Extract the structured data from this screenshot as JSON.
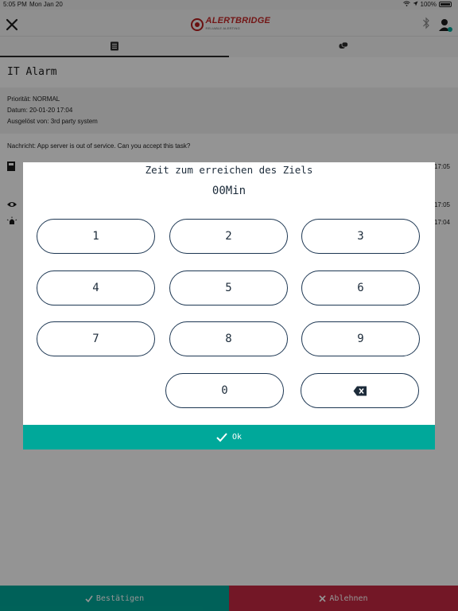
{
  "status_bar": {
    "time": "5:05 PM",
    "date": "Mon Jan 20",
    "battery": "100%"
  },
  "header": {
    "logo_text": "ALERTBRIDGE",
    "logo_subtext": "RELIABLE ALERTING"
  },
  "alarm": {
    "title": "IT Alarm",
    "priority": "Priorität: NORMAL",
    "date": "Datum: 20-01-20 17:04",
    "triggered_by": "Ausgelöst von: 3rd party system",
    "message": "Nachricht: App server is out of service. Can you accept this task?"
  },
  "history": [
    {
      "icon": "pager-icon",
      "time": "17:05"
    },
    {
      "icon": "eye-icon",
      "time": "17:05"
    },
    {
      "icon": "alarm-bell-icon",
      "time": "17:04"
    }
  ],
  "dialog": {
    "title": "Zeit zum erreichen des Ziels",
    "value": "00Min",
    "keys": [
      "1",
      "2",
      "3",
      "4",
      "5",
      "6",
      "7",
      "8",
      "9",
      "0"
    ],
    "ok_label": "Ok"
  },
  "actions": {
    "confirm_label": "Bestätigen",
    "decline_label": "Ablehnen"
  },
  "colors": {
    "accent": "#00a89a",
    "decline": "#c62842",
    "brand": "#c62828"
  }
}
